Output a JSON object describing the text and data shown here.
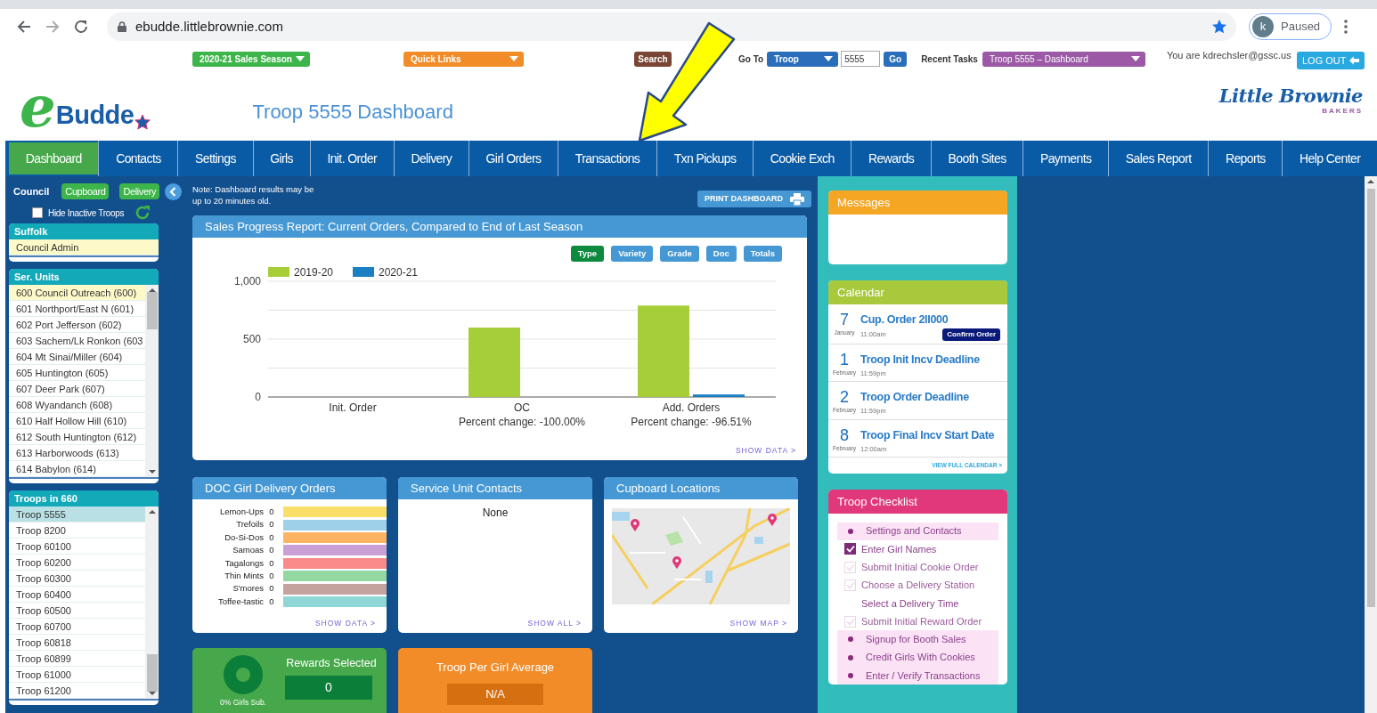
{
  "browser": {
    "url": "ebudde.littlebrownie.com",
    "profile_initial": "k",
    "profile_status": "Paused"
  },
  "header": {
    "season": "2020-21 Sales Season",
    "quick_links": "Quick Links",
    "search_button": "Search",
    "go_to_label": "Go To",
    "go_to_select": "Troop",
    "go_to_value": "5555",
    "go_button": "Go",
    "recent_tasks_label": "Recent Tasks",
    "recent_tasks_select": "Troop 5555 – Dashboard",
    "user_text": "You are kdrechsler@gssc.us",
    "logout_button": "LOG OUT",
    "logo_letter": "e",
    "logo_word": "Budde",
    "page_title": "Troop 5555 Dashboard",
    "brand_name": "Little Brownie",
    "brand_sub": "BAKERS"
  },
  "nav": {
    "items": [
      {
        "label": "Dashboard",
        "selected": true
      },
      {
        "label": "Contacts",
        "selected": false
      },
      {
        "label": "Settings",
        "selected": false
      },
      {
        "label": "Girls",
        "selected": false
      },
      {
        "label": "Init. Order",
        "selected": false
      },
      {
        "label": "Delivery",
        "selected": false
      },
      {
        "label": "Girl Orders",
        "selected": false
      },
      {
        "label": "Transactions",
        "selected": false
      },
      {
        "label": "Txn Pickups",
        "selected": false
      },
      {
        "label": "Cookie Exch",
        "selected": false
      },
      {
        "label": "Rewards",
        "selected": false
      },
      {
        "label": "Booth Sites",
        "selected": false
      },
      {
        "label": "Payments",
        "selected": false
      },
      {
        "label": "Sales Report",
        "selected": false
      },
      {
        "label": "Reports",
        "selected": false
      },
      {
        "label": "Help Center",
        "selected": false
      }
    ]
  },
  "sidebar": {
    "council_label": "Council",
    "buttons": [
      "Cupboard",
      "Delivery"
    ],
    "hide_inactive": {
      "label": "Hide Inactive Troops",
      "checked": false
    },
    "council": {
      "title": "Suffolk",
      "items": [
        {
          "label": "Council Admin",
          "selected": true
        }
      ]
    },
    "service_units": {
      "title": "Ser. Units",
      "items": [
        {
          "label": "600 Council Outreach (600)",
          "selected": true
        },
        {
          "label": "601 Northport/East N (601)",
          "selected": false
        },
        {
          "label": "602 Port Jefferson (602)",
          "selected": false
        },
        {
          "label": "603 Sachem/Lk Ronkon (603",
          "selected": false
        },
        {
          "label": "604 Mt Sinai/Miller (604)",
          "selected": false
        },
        {
          "label": "605 Huntington (605)",
          "selected": false
        },
        {
          "label": "607 Deer Park (607)",
          "selected": false
        },
        {
          "label": "608 Wyandanch (608)",
          "selected": false
        },
        {
          "label": "610 Half Hollow Hill (610)",
          "selected": false
        },
        {
          "label": "612 South Huntington (612)",
          "selected": false
        },
        {
          "label": "613 Harborwoods (613)",
          "selected": false
        },
        {
          "label": "614 Babylon (614)",
          "selected": false
        }
      ]
    },
    "troops": {
      "title": "Troops in 660",
      "items": [
        {
          "label": "Troop 5555",
          "selected": true
        },
        {
          "label": "Troop 8200",
          "selected": false
        },
        {
          "label": "Troop 60100",
          "selected": false
        },
        {
          "label": "Troop 60200",
          "selected": false
        },
        {
          "label": "Troop 60300",
          "selected": false
        },
        {
          "label": "Troop 60400",
          "selected": false
        },
        {
          "label": "Troop 60500",
          "selected": false
        },
        {
          "label": "Troop 60700",
          "selected": false
        },
        {
          "label": "Troop 60818",
          "selected": false
        },
        {
          "label": "Troop 60899",
          "selected": false
        },
        {
          "label": "Troop 61000",
          "selected": false
        },
        {
          "label": "Troop 61200",
          "selected": false
        }
      ]
    }
  },
  "main": {
    "note": "Note: Dashboard results may be up to 20 minutes old.",
    "print_button": "PRINT DASHBOARD",
    "sales_chart": {
      "title": "Sales Progress Report: Current Orders, Compared to End of Last Season",
      "views": [
        {
          "label": "Type",
          "selected": true
        },
        {
          "label": "Variety",
          "selected": false
        },
        {
          "label": "Grade",
          "selected": false
        },
        {
          "label": "Doc",
          "selected": false
        },
        {
          "label": "Totals",
          "selected": false
        }
      ],
      "chart_data": {
        "type": "bar",
        "categories": [
          "Init. Order",
          "OC",
          "Add. Orders"
        ],
        "series": [
          {
            "name": "2019-20",
            "color": "#a6ce39",
            "values": [
              0,
              600,
              790
            ]
          },
          {
            "name": "2020-21",
            "color": "#1b7fc4",
            "values": [
              0,
              0,
              22
            ]
          }
        ],
        "ylim": [
          0,
          1000
        ],
        "yticks": [
          0,
          {
            "value": 500,
            "label": "500"
          },
          {
            "value": 1000,
            "label": "1,000"
          }
        ],
        "legend": true,
        "annotations": [
          "Percent change: -100.00%",
          "Percent change: -96.51%"
        ]
      },
      "link": "SHOW DATA >"
    },
    "doc_orders": {
      "title": "DOC Girl Delivery Orders",
      "items": [
        {
          "name": "Lemon-Ups",
          "count": "0",
          "color": "#f9df6a"
        },
        {
          "name": "Trefoils",
          "count": "0",
          "color": "#9fd0ea"
        },
        {
          "name": "Do-Si-Dos",
          "count": "0",
          "color": "#fdb462"
        },
        {
          "name": "Samoas",
          "count": "0",
          "color": "#c9a0d6"
        },
        {
          "name": "Tagalongs",
          "count": "0",
          "color": "#fb8a8a"
        },
        {
          "name": "Thin Mints",
          "count": "0",
          "color": "#93d8a0"
        },
        {
          "name": "S'mores",
          "count": "0",
          "color": "#c4a39e"
        },
        {
          "name": "Toffee-tastic",
          "count": "0",
          "color": "#8fd6d6"
        }
      ],
      "link": "SHOW DATA >"
    },
    "contacts": {
      "title": "Service Unit Contacts",
      "text": "None",
      "link": "SHOW ALL >"
    },
    "cupboards": {
      "title": "Cupboard Locations",
      "link": "SHOW MAP >"
    },
    "rewards": {
      "caption": "0% Girls Sub.",
      "title": "Rewards Selected",
      "value": "0"
    },
    "per_girl": {
      "title": "Troop Per Girl Average",
      "value": "N/A"
    }
  },
  "right": {
    "messages": {
      "title": "Messages"
    },
    "calendar": {
      "title": "Calendar",
      "events": [
        {
          "day": "7",
          "month": "January",
          "title": "Cup. Order 2II000",
          "time": "11:00am",
          "badge": "Confirm Order"
        },
        {
          "day": "1",
          "month": "February",
          "title": "Troop Init Incv Deadline",
          "time": "11:59pm"
        },
        {
          "day": "2",
          "month": "February",
          "title": "Troop Order Deadline",
          "time": "11:59pm"
        },
        {
          "day": "8",
          "month": "February",
          "title": "Troop Final Incv Start Date",
          "time": "12:00am"
        }
      ],
      "link": "VIEW FULL CALENDAR >"
    },
    "checklist": {
      "title": "Troop Checklist",
      "items": [
        {
          "label": "Settings and Contacts",
          "kind": "bullet",
          "highlighted": true
        },
        {
          "label": "Enter Girl Names",
          "kind": "check",
          "highlighted": false,
          "checked": true
        },
        {
          "label": "Submit Initial Cookie Order",
          "kind": "check",
          "highlighted": false,
          "checked": false
        },
        {
          "label": "Choose a Delivery Station",
          "kind": "check",
          "highlighted": false,
          "checked": false
        },
        {
          "label": "Select a Delivery Time",
          "kind": "plain",
          "highlighted": false
        },
        {
          "label": "Submit Initial Reward Order",
          "kind": "check",
          "highlighted": false,
          "checked": false
        },
        {
          "label": "Signup for Booth Sales",
          "kind": "bullet",
          "highlighted": true
        },
        {
          "label": "Credit Girls With Cookies",
          "kind": "bullet",
          "highlighted": true
        },
        {
          "label": "Enter / Verify Transactions",
          "kind": "bullet",
          "highlighted": true
        }
      ]
    }
  }
}
